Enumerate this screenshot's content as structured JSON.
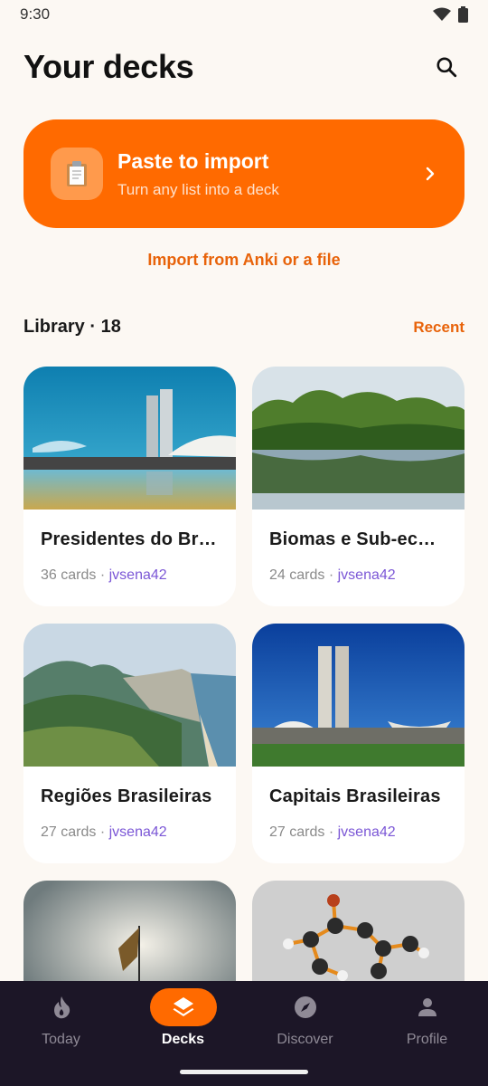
{
  "status_bar": {
    "time": "9:30",
    "icons": [
      "wifi-icon",
      "battery-icon"
    ]
  },
  "header": {
    "title": "Your decks",
    "search_icon": "search-icon"
  },
  "import_card": {
    "title": "Paste to import",
    "subtitle": "Turn any list into a deck",
    "icon": "clipboard-icon",
    "chevron": "chevron-right-icon"
  },
  "anki_link": "Import from Anki or a file",
  "library": {
    "label": "Library · 18",
    "sort": "Recent"
  },
  "decks": [
    {
      "title": "Presidentes do Br…",
      "count": "36 cards",
      "separator": "·",
      "author": "jvsena42",
      "image": "congress-building"
    },
    {
      "title": "Biomas e Sub-ec…",
      "count": "24 cards",
      "separator": "·",
      "author": "jvsena42",
      "image": "amazon-river"
    },
    {
      "title": "Regiões Brasileiras",
      "count": "27 cards",
      "separator": "·",
      "author": "jvsena42",
      "image": "rio-mountains"
    },
    {
      "title": "Capitais Brasileiras",
      "count": "27 cards",
      "separator": "·",
      "author": "jvsena42",
      "image": "brasilia-congress"
    },
    {
      "title": "",
      "count": "",
      "separator": "",
      "author": "",
      "image": "flag"
    },
    {
      "title": "",
      "count": "",
      "separator": "",
      "author": "",
      "image": "molecule"
    }
  ],
  "bottom_nav": [
    {
      "label": "Today",
      "icon": "flame-icon",
      "active": false
    },
    {
      "label": "Decks",
      "icon": "layers-icon",
      "active": true
    },
    {
      "label": "Discover",
      "icon": "compass-icon",
      "active": false
    },
    {
      "label": "Profile",
      "icon": "person-icon",
      "active": false
    }
  ],
  "colors": {
    "accent": "#ff6a00",
    "link": "#e8630a",
    "author": "#7b57d6",
    "nav_bg": "#1c1627",
    "background": "#fcf8f3"
  }
}
